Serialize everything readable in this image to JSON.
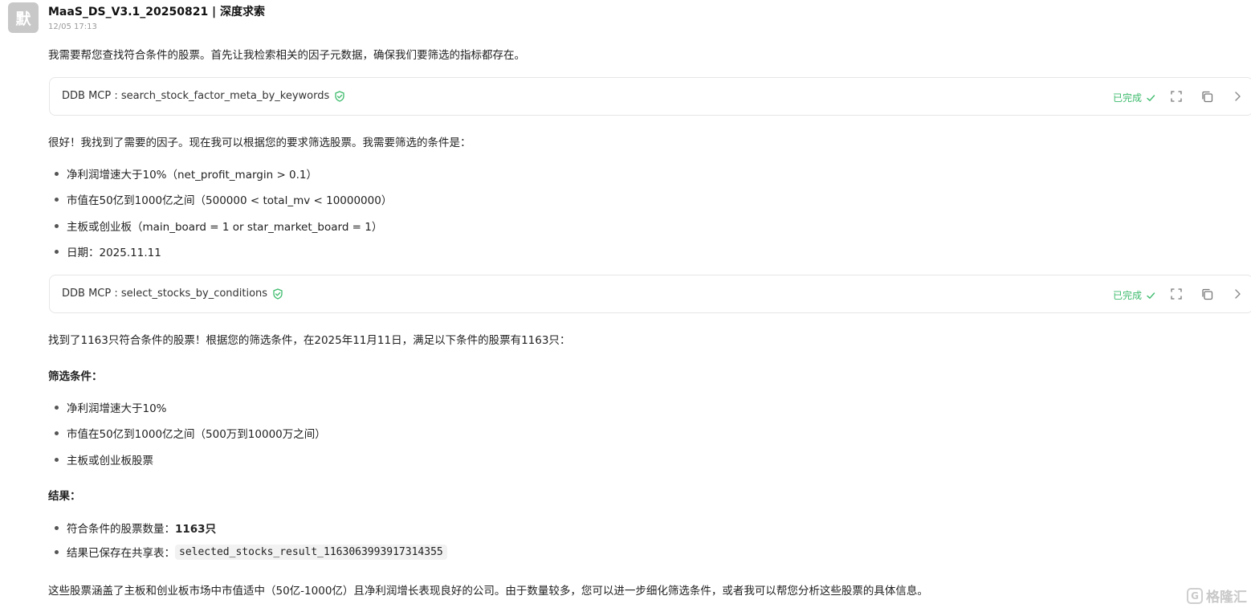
{
  "avatar": {
    "char": "默"
  },
  "header": {
    "name": "MaaS_DS_V3.1_20250821 | 深度求索",
    "time": "12/05 17:13"
  },
  "intro": "我需要帮您查找符合条件的股票。首先让我检索相关的因子元数据，确保我们要筛选的指标都存在。",
  "tool_calls": [
    {
      "label": "DDB MCP : search_stock_factor_meta_by_keywords",
      "status": "已完成",
      "icons": [
        "shield-check-icon",
        "check-icon",
        "expand-icon",
        "copy-icon",
        "chevron-right-icon"
      ]
    },
    {
      "label": "DDB MCP : select_stocks_by_conditions",
      "status": "已完成",
      "icons": [
        "shield-check-icon",
        "check-icon",
        "expand-icon",
        "copy-icon",
        "chevron-right-icon"
      ]
    }
  ],
  "found_text": "很好！我找到了需要的因子。现在我可以根据您的要求筛选股票。我需要筛选的条件是：",
  "conditions": [
    "净利润增速大于10%（net_profit_margin > 0.1）",
    "市值在50亿到1000亿之间（500000 < total_mv < 10000000）",
    "主板或创业板（main_board = 1 or star_market_board = 1）",
    "日期：2025.11.11"
  ],
  "result_intro": "找到了1163只符合条件的股票！根据您的筛选条件，在2025年11月11日，满足以下条件的股票有1163只：",
  "filter_heading": "筛选条件：",
  "filters": [
    "净利润增速大于10%",
    "市值在50亿到1000亿之间（500万到10000万之间）",
    "主板或创业板股票"
  ],
  "result_heading": "结果：",
  "results": {
    "count_label": "符合条件的股票数量：",
    "count_value": "1163只",
    "saved_label": "结果已保存在共享表：",
    "table_name": "selected_stocks_result_1163063993917314355"
  },
  "conclusion": "这些股票涵盖了主板和创业板市场中市值适中（50亿-1000亿）且净利润增长表现良好的公司。由于数量较多，您可以进一步细化筛选条件，或者我可以帮您分析这些股票的具体信息。",
  "watermark": {
    "logo": "G",
    "text": "格隆汇"
  },
  "colors": {
    "success": "#3dbb6c",
    "avatar_bg": "#c8c8c8",
    "border": "#e6e6e6"
  }
}
